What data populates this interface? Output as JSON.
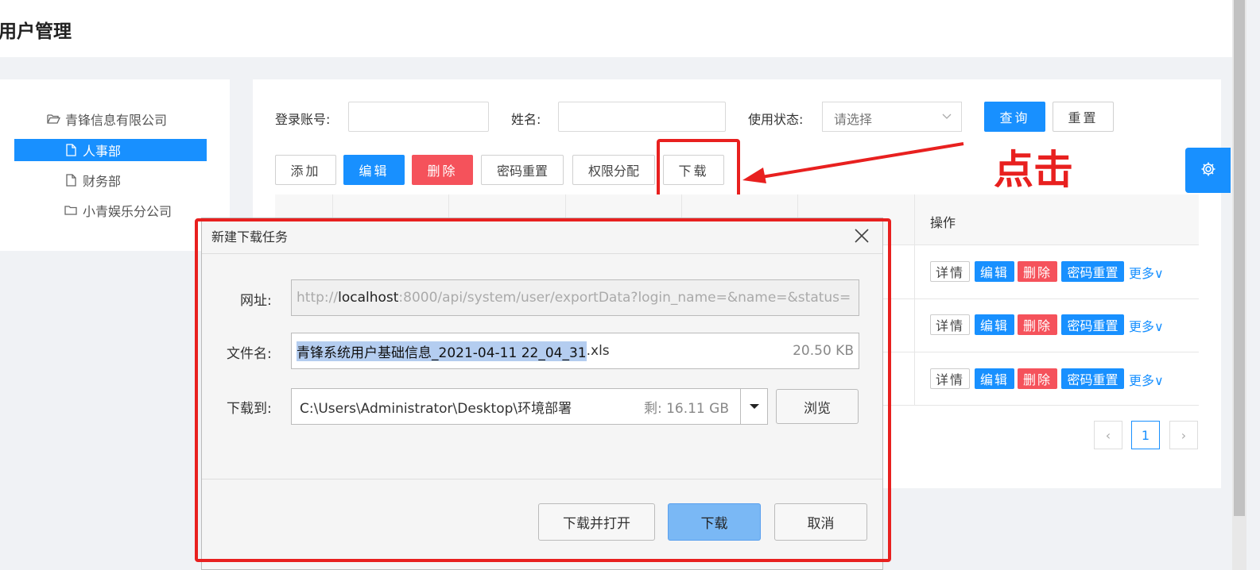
{
  "header": {
    "title": "用户管理"
  },
  "tree": {
    "items": [
      {
        "label": "青锋信息有限公司"
      },
      {
        "label": "人事部"
      },
      {
        "label": "财务部"
      },
      {
        "label": "小青娱乐分公司"
      }
    ]
  },
  "search": {
    "login_label": "登录账号:",
    "name_label": "姓名:",
    "status_label": "使用状态:",
    "status_placeholder": "请选择",
    "query_label": "查询",
    "reset_label": "重置"
  },
  "toolbar": {
    "add": "添加",
    "edit": "编辑",
    "delete": "删除",
    "password_reset": "密码重置",
    "permission": "权限分配",
    "download": "下载"
  },
  "table": {
    "op_header": "操作",
    "row_actions": {
      "detail": "详情",
      "edit": "编辑",
      "delete": "删除",
      "reset": "密码重置",
      "more": "更多∨"
    },
    "row_count": 3
  },
  "pagination": {
    "prev": "‹",
    "current": "1",
    "next": "›"
  },
  "annotation": {
    "text": "点击"
  },
  "dialog": {
    "title": "新建下载任务",
    "url_label": "网址:",
    "url_prefix": "http://",
    "url_host": "localhost",
    "url_rest": ":8000/api/system/user/exportData?login_name=&name=&status=",
    "filename_label": "文件名:",
    "filename_selected": "青锋系统用户基础信息_2021-04-11 22_04_31",
    "filename_ext": ".xls",
    "filesize": "20.50 KB",
    "saveto_label": "下载到:",
    "saveto_path": "C:\\Users\\Administrator\\Desktop\\环境部署",
    "free_space": "剩: 16.11 GB",
    "browse": "浏览",
    "download_open": "下载并打开",
    "download": "下载",
    "cancel": "取消"
  },
  "colors": {
    "primary": "#1890ff",
    "danger": "#f5525b",
    "annotation": "#e8201f"
  }
}
